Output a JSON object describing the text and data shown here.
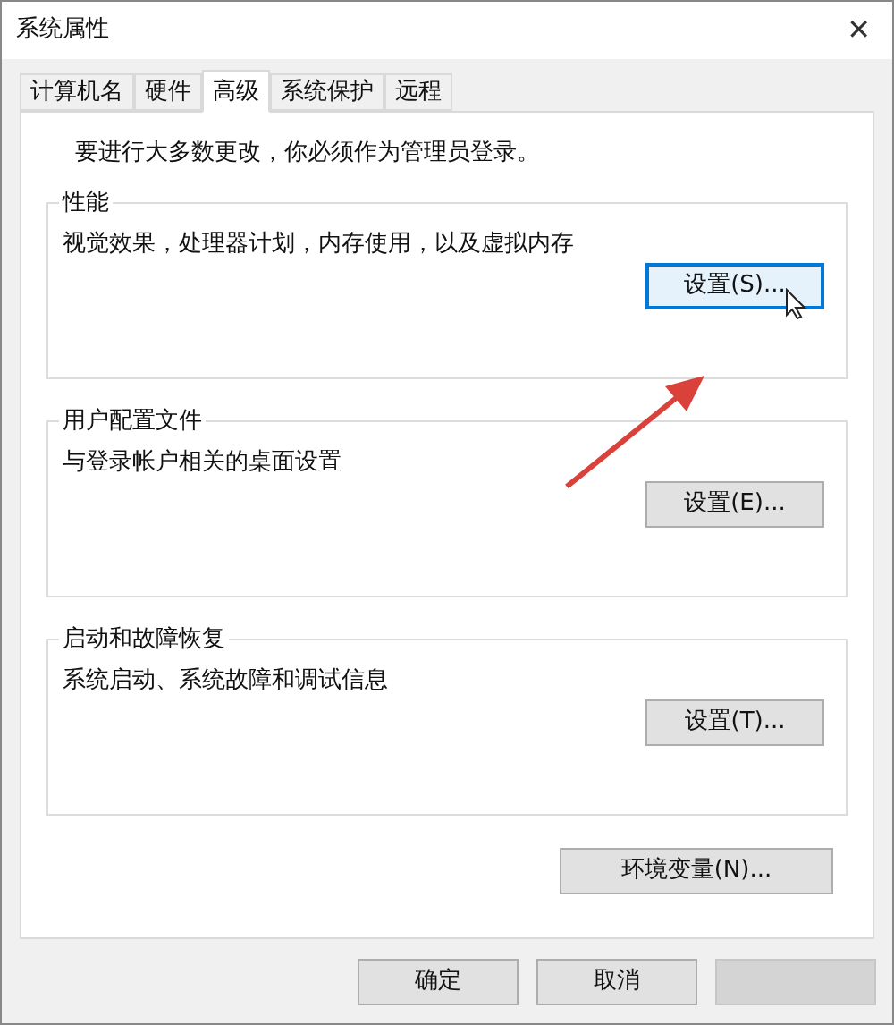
{
  "window": {
    "title": "系统属性",
    "close": "✕"
  },
  "tabs": [
    {
      "label": "计算机名",
      "selected": false
    },
    {
      "label": "硬件",
      "selected": false
    },
    {
      "label": "高级",
      "selected": true
    },
    {
      "label": "系统保护",
      "selected": false
    },
    {
      "label": "远程",
      "selected": false
    }
  ],
  "notice": "要进行大多数更改，你必须作为管理员登录。",
  "groups": [
    {
      "title": "性能",
      "description": "视觉效果，处理器计划，内存使用，以及虚拟内存",
      "button": "设置(S)...",
      "focused": true
    },
    {
      "title": "用户配置文件",
      "description": "与登录帐户相关的桌面设置",
      "button": "设置(E)...",
      "focused": false
    },
    {
      "title": "启动和故障恢复",
      "description": "系统启动、系统故障和调试信息",
      "button": "设置(T)...",
      "focused": false
    }
  ],
  "environment_button": "环境变量(N)...",
  "footer_buttons": [
    "确定",
    "取消"
  ]
}
